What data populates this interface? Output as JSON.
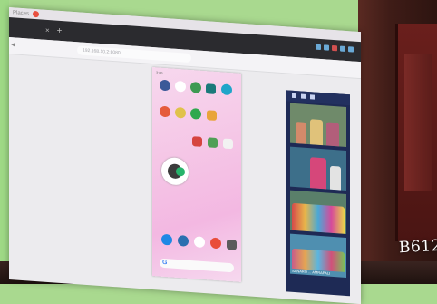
{
  "scene": {
    "type": "photo-of-projected-screen",
    "watermark": "B612"
  },
  "browser": {
    "window_title": "Places",
    "new_tab_symbol": "+",
    "tab_close_symbol": "×",
    "url": "192.168.10.2:8080"
  },
  "phone_mirror": {
    "status_bar": "3:05",
    "search_logo": "G"
  },
  "participants": {
    "tile_labels": [
      "",
      "",
      "",
      "SANARO ... AMRAPALI"
    ]
  },
  "colors": {
    "wall_green": "#a9d98f",
    "tabbar": "#2b2b2f",
    "close_dot": "#e8503f",
    "panel": "#1e2a55",
    "phone_bg": "#f5c6e6"
  },
  "icons": [
    "close-icon",
    "back-icon",
    "new-tab-icon",
    "google-search-icon"
  ]
}
